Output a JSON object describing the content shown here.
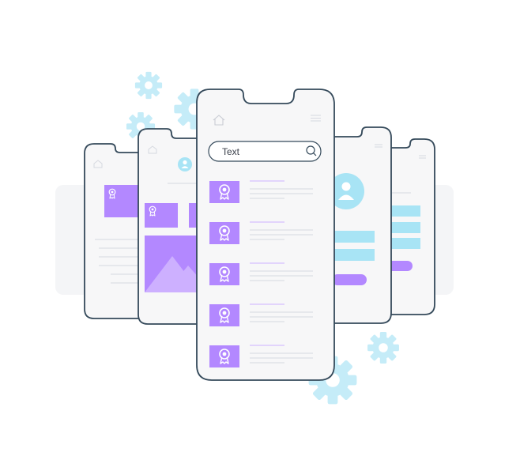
{
  "search": {
    "text": "Text"
  },
  "colors": {
    "outline": "#34495a",
    "phone_fill": "#f7f7f8",
    "accent_purple": "#b388ff",
    "accent_purple_light": "#cdb0ff",
    "accent_blue": "#a8e4f5",
    "gear_blue": "#c5ecf8",
    "line_gray": "#d6d9e0",
    "backdrop": "#f4f5f7"
  },
  "icons": {
    "home": "home-icon",
    "menu": "hamburger-menu-icon",
    "search": "search-icon",
    "award": "award-ribbon-icon",
    "user": "user-avatar-icon",
    "gear": "gear-icon",
    "image": "mountain-image-icon"
  },
  "list": {
    "item_count": 5
  }
}
